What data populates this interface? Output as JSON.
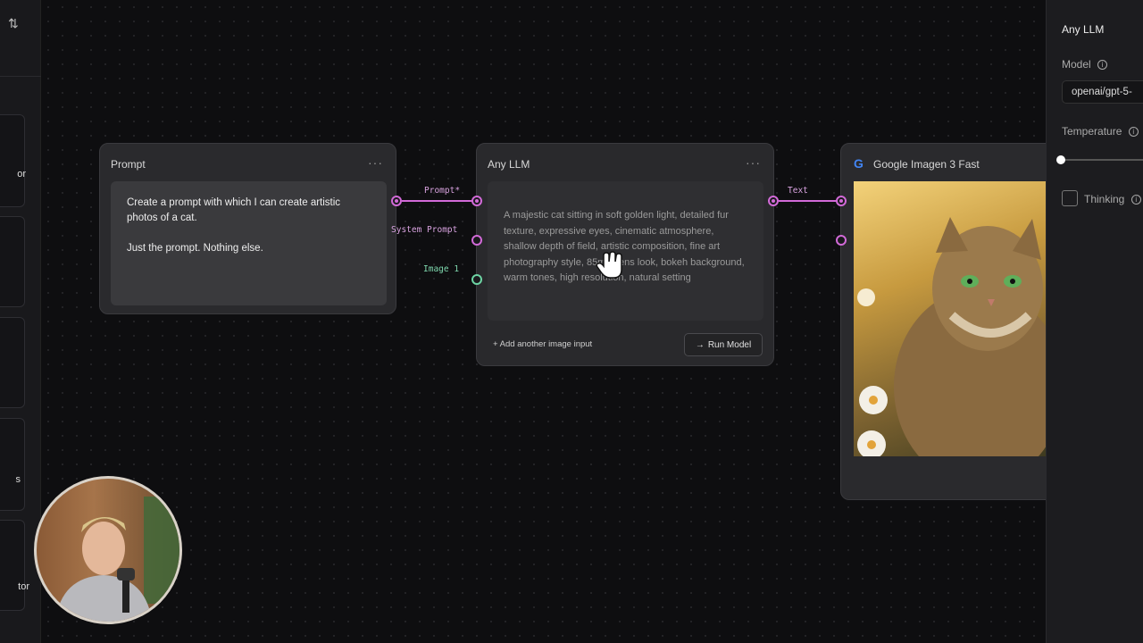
{
  "left_rail": {
    "sort_icon": "sort-arrows-icon",
    "partial_labels": [
      "or",
      "s",
      "tor"
    ]
  },
  "prompt_node": {
    "title": "Prompt",
    "menu": "···",
    "text_line1": "Create a prompt with which I can create artistic photos of a cat.",
    "text_line2": "Just the prompt. Nothing else."
  },
  "llm_node": {
    "title": "Any LLM",
    "menu": "···",
    "output": "A majestic cat sitting in soft golden light, detailed fur texture, expressive eyes, cinematic atmosphere, shallow depth of field, artistic composition, fine art photography style, 85mm lens look, bokeh background, warm tones, high resolution, natural setting",
    "add_image_input": "Add another image input",
    "run_button": "Run Model",
    "inputs": {
      "prompt": "Prompt*",
      "system_prompt": "System Prompt",
      "image": "Image 1"
    },
    "output_label": "Text"
  },
  "image_node": {
    "title": "Google Imagen 3 Fast",
    "image_alt": "cat"
  },
  "right_panel": {
    "title": "Any LLM",
    "model_label": "Model",
    "model_value": "openai/gpt-5-",
    "temperature_label": "Temperature",
    "temperature_value": 0,
    "thinking_label": "Thinking",
    "thinking_checked": false
  },
  "colors": {
    "accent_text_port": "#d26ad8",
    "accent_image_port": "#6dd3a3"
  }
}
